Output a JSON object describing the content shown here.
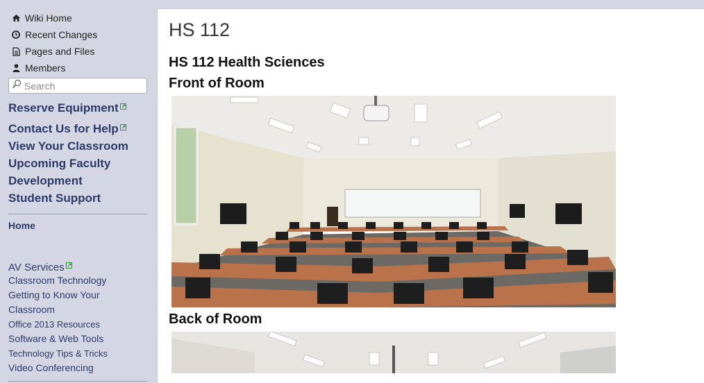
{
  "sidebar": {
    "top_links": [
      {
        "label": "Wiki Home",
        "icon": "home-icon"
      },
      {
        "label": "Recent Changes",
        "icon": "clock-icon"
      },
      {
        "label": "Pages and Files",
        "icon": "document-icon"
      },
      {
        "label": "Members",
        "icon": "person-icon"
      }
    ],
    "search_placeholder": "Search",
    "bold_links": [
      "Reserve Equipment",
      "Contact Us for Help",
      "View Your Classroom",
      "Upcoming Faculty",
      "Development",
      "Student Support"
    ],
    "home_label": "Home",
    "av_services_label": "AV Services",
    "av_sub_links": [
      "Classroom Technology",
      "Getting to Know Your",
      "Classroom",
      "Office 2013 Resources",
      "Software & Web Tools",
      "Technology Tips & Tricks",
      "Video Conferencing"
    ]
  },
  "main": {
    "page_title": "HS 112",
    "section_title": "HS 112 Health Sciences",
    "front_heading": "Front of Room",
    "back_heading": "Back of Room"
  },
  "colors": {
    "sidebar_bg": "#d4d6e3",
    "nav_link": "#2b3a67",
    "external_link_icon": "#2a9a2a"
  }
}
